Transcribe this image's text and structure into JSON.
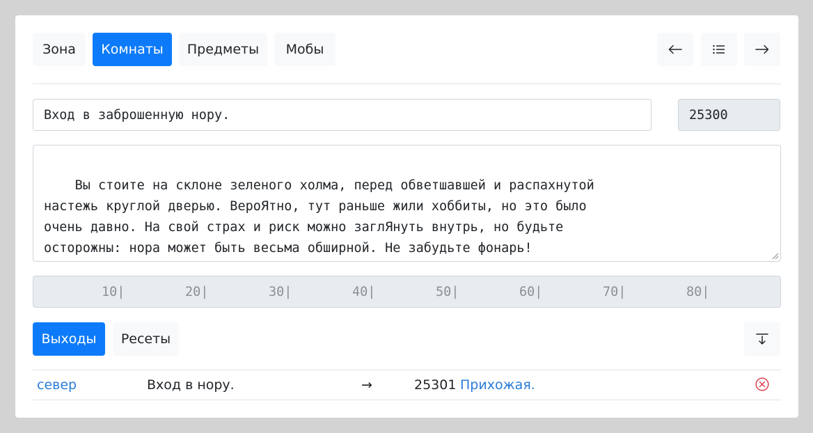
{
  "tabs": [
    {
      "label": "Зона",
      "active": false
    },
    {
      "label": "Комнаты",
      "active": true
    },
    {
      "label": "Предметы",
      "active": false
    },
    {
      "label": "Мобы",
      "active": false
    }
  ],
  "nav": {
    "prev_icon": "arrow-left-icon",
    "list_icon": "list-icon",
    "next_icon": "arrow-right-icon"
  },
  "room": {
    "name": "Вход в заброшенную нору.",
    "vnum": "25300",
    "description": "Вы стоите на склоне зеленого холма, перед обветшавшей и распахнутой\nнастежь круглой дверью. ВероЯтно, тут раньше жили хоббиты, но это было\nочень давно. На свой страх и риск можно заглЯнуть внутрь, но будьте\nосторожны: нора может быть весьма обширной. Не забудьте фонарь!"
  },
  "ruler": [
    "10|",
    "20|",
    "30|",
    "40|",
    "50|",
    "60|",
    "70|",
    "80|"
  ],
  "subtabs": [
    {
      "label": "Выходы",
      "active": true
    },
    {
      "label": "Ресеты",
      "active": false
    }
  ],
  "collapse_icon": "arrow-down-to-line-icon",
  "exits": [
    {
      "direction": "север",
      "description": "Вход в нору.",
      "arrow": "→",
      "target_vnum": "25301",
      "target_name": "Прихожая.",
      "delete_icon": "circle-x-icon"
    }
  ],
  "colors": {
    "primary": "#0d7bf9",
    "link": "#2a7bd6",
    "danger": "#dc3545"
  }
}
